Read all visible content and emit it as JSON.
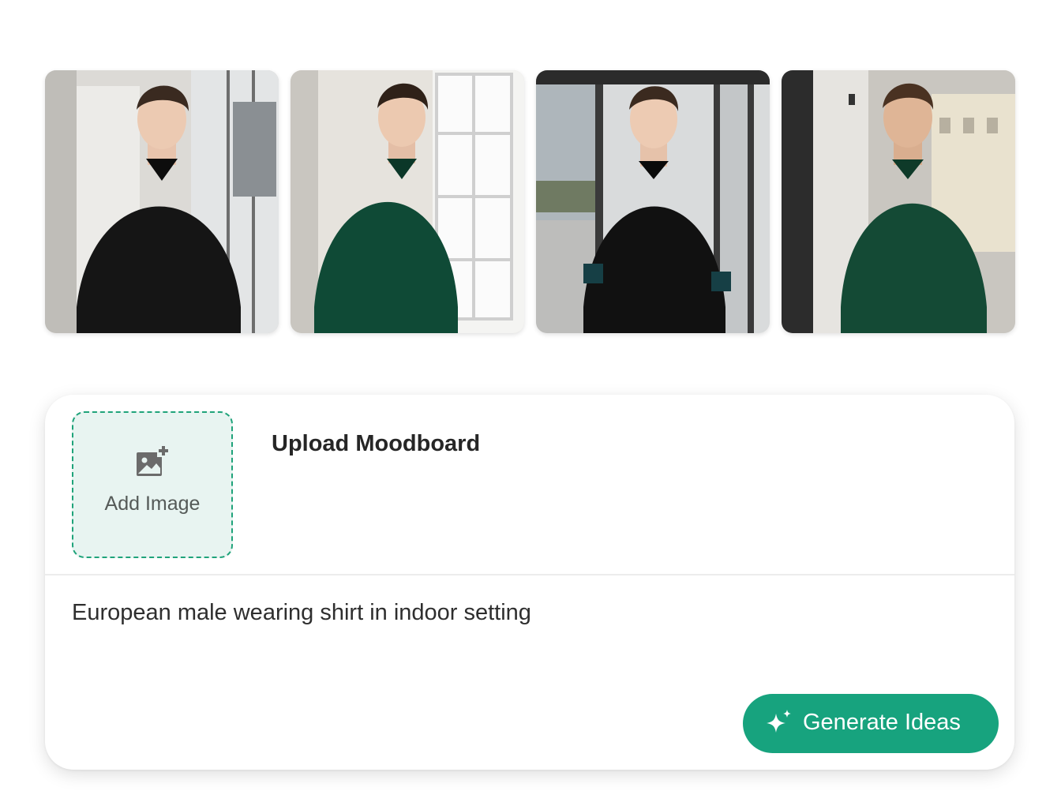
{
  "gallery": {
    "photos": [
      {
        "alt": "model in black shirt",
        "shirt": "#141414"
      },
      {
        "alt": "model in green shirt",
        "shirt": "#0f4a36"
      },
      {
        "alt": "model in black shirt",
        "shirt": "#121212"
      },
      {
        "alt": "model in green shirt",
        "shirt": "#144a35"
      }
    ]
  },
  "upload": {
    "add_image_label": "Add Image",
    "title": "Upload Moodboard"
  },
  "prompt": {
    "text": "European male wearing shirt in indoor setting"
  },
  "actions": {
    "generate_label": "Generate Ideas"
  },
  "colors": {
    "accent": "#17a37e",
    "dropzone_border": "#1fa37a",
    "dropzone_bg": "#e8f4f1"
  }
}
